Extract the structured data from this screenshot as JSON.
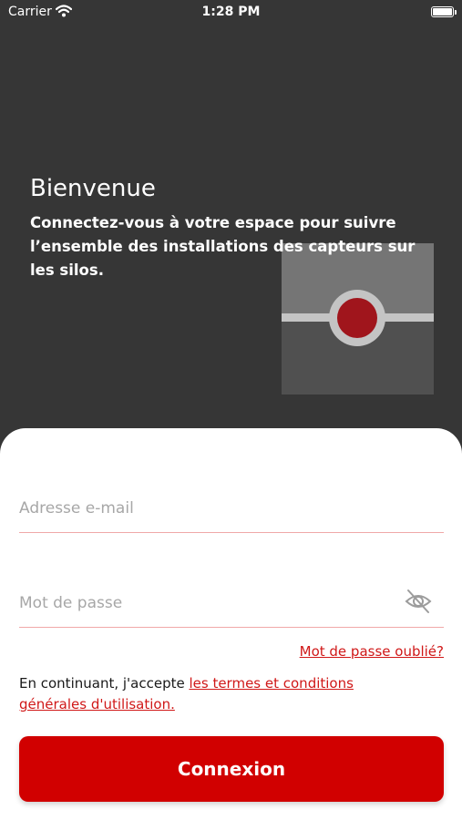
{
  "status_bar": {
    "carrier": "Carrier",
    "time": "1:28 PM"
  },
  "welcome": {
    "title": "Bienvenue",
    "text": "Connectez-vous à votre espace pour suivre l’ensemble des installations des capteurs sur les silos."
  },
  "form": {
    "email_placeholder": "Adresse e-mail",
    "email_value": "",
    "password_placeholder": "Mot de passe",
    "password_value": "",
    "forgot_password": "Mot de passe oublié?",
    "terms_prefix": "En continuant, j'accepte ",
    "terms_link": "les termes et conditions générales d'utilisation.",
    "submit_label": "Connexion"
  },
  "colors": {
    "accent": "#d10000",
    "background": "#363636",
    "sheet": "#ffffff"
  },
  "icons": {
    "password_toggle": "eye-off-icon",
    "wifi": "wifi-icon",
    "battery": "battery-icon"
  }
}
